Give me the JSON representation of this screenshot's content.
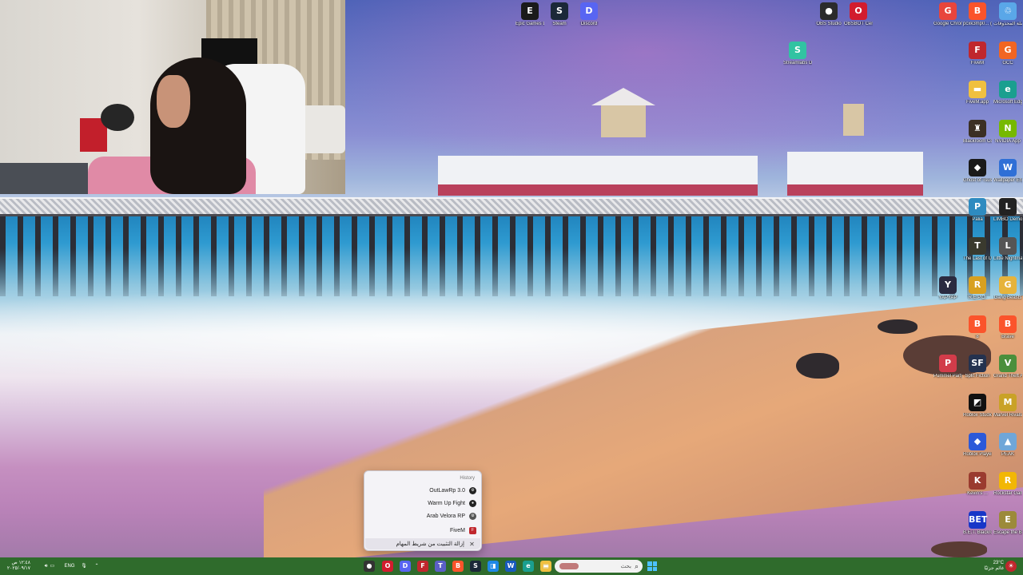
{
  "desktop": {
    "icons_top": [
      {
        "label": "Epic Games Launcher",
        "glyph": "E",
        "color": "#1a1a1a",
        "icon": "epic-games-icon"
      },
      {
        "label": "Steam",
        "glyph": "S",
        "color": "#1b2838",
        "icon": "steam-icon"
      },
      {
        "label": "Discord",
        "glyph": "D",
        "color": "#5865f2",
        "icon": "discord-icon"
      },
      {
        "label": "OBS Studio",
        "glyph": "●",
        "color": "#2b2b2b",
        "icon": "obs-icon"
      },
      {
        "label": "OBSBOT Center",
        "glyph": "O",
        "color": "#d21c2e",
        "icon": "obsbot-icon"
      },
      {
        "label": "Streamlabs Desktop",
        "glyph": "S",
        "color": "#31c3a2",
        "icon": "streamlabs-icon"
      }
    ],
    "icons_right": [
      {
        "label": "Google Chrome",
        "glyph": "G",
        "color": "#e8453c",
        "icon": "chrome-icon"
      },
      {
        "label": "pcxk3mp0... (2)",
        "glyph": "B",
        "color": "#fb542b",
        "icon": "brave-icon"
      },
      {
        "label": "سلة المحذوفات",
        "glyph": "♲",
        "color": "#5aa7e8",
        "icon": "recycle-bin-icon"
      },
      {
        "label": "FiveM",
        "glyph": "F",
        "color": "#c0272d",
        "icon": "fivem-icon"
      },
      {
        "label": "GCC",
        "glyph": "G",
        "color": "#f26522",
        "icon": "gcc-icon"
      },
      {
        "label": "FiveM.app",
        "glyph": "▬",
        "color": "#f0c040",
        "icon": "folder-icon"
      },
      {
        "label": "Microsoft Edge",
        "glyph": "e",
        "color": "#1a9f8f",
        "icon": "edge-icon"
      },
      {
        "label": "Blackroom Company",
        "glyph": "♜",
        "color": "#3b2f24",
        "icon": "blackroom-icon"
      },
      {
        "label": "NVIDIA App",
        "glyph": "N",
        "color": "#76b900",
        "icon": "nvidia-icon"
      },
      {
        "label": "Ghost of Tsushima",
        "glyph": "◆",
        "color": "#1a1a1a",
        "icon": "ghost-icon"
      },
      {
        "label": "Wallpaper Engine",
        "glyph": "W",
        "color": "#2f6fd6",
        "icon": "wallpaper-engine-icon"
      },
      {
        "label": "Palia",
        "glyph": "P",
        "color": "#2e8bc0",
        "icon": "palia-icon"
      },
      {
        "label": "LIMBO Demo",
        "glyph": "L",
        "color": "#222222",
        "icon": "limbo-icon"
      },
      {
        "label": "The Last of Us™ Part I",
        "glyph": "T",
        "color": "#3a3a2e",
        "icon": "tlou-icon"
      },
      {
        "label": "Little Nightmares",
        "glyph": "L",
        "color": "#555555",
        "icon": "little-nightmares-icon"
      },
      {
        "label": "YAPYAP",
        "glyph": "Y",
        "color": "#2b2b40",
        "icon": "yapyap-icon"
      },
      {
        "label": "R.E.P.O.",
        "glyph": "R",
        "color": "#d8a020",
        "icon": "repo-icon"
      },
      {
        "label": "Gang Beasts",
        "glyph": "G",
        "color": "#e6b33b",
        "icon": "gang-beasts-icon"
      },
      {
        "label": "8",
        "glyph": "B",
        "color": "#fb542b",
        "icon": "brave-icon"
      },
      {
        "label": "Brave",
        "glyph": "B",
        "color": "#fb542b",
        "icon": "brave-icon"
      },
      {
        "label": "Pummel Party",
        "glyph": "P",
        "color": "#d23c4a",
        "icon": "pummel-party-icon"
      },
      {
        "label": "Split Fiction",
        "glyph": "SF",
        "color": "#24324f",
        "icon": "split-fiction-icon"
      },
      {
        "label": "Grand Theft Auto V Le...",
        "glyph": "V",
        "color": "#4a8f3c",
        "icon": "gta-icon"
      },
      {
        "label": "Roblox Studio",
        "glyph": "◩",
        "color": "#111111",
        "icon": "roblox-studio-icon"
      },
      {
        "label": "Marvel Rivals",
        "glyph": "M",
        "color": "#c9a227",
        "icon": "marvel-rivals-icon"
      },
      {
        "label": "Roblox Player",
        "glyph": "◆",
        "color": "#2b59d9",
        "icon": "roblox-player-icon"
      },
      {
        "label": "PEAK",
        "glyph": "▲",
        "color": "#6fa6d8",
        "icon": "peak-icon"
      },
      {
        "label": "Kevin's ...",
        "glyph": "K",
        "color": "#9a3b2f",
        "icon": "game-icon"
      },
      {
        "label": "Rockstar Games ...",
        "glyph": "R",
        "color": "#f2b705",
        "icon": "rockstar-icon"
      },
      {
        "label": "B.E.T. Blackroom Escape T...",
        "glyph": "BET",
        "color": "#1836c8",
        "icon": "bet-icon"
      },
      {
        "label": "Escape the Backrooms",
        "glyph": "E",
        "color": "#9c8a3a",
        "icon": "escape-backrooms-icon"
      }
    ]
  },
  "jumplist": {
    "header": "History",
    "items": [
      {
        "label": "OutLawRp 3.0",
        "icon": "fivem-server-icon",
        "kind": "round"
      },
      {
        "label": "Warm Up Fight",
        "icon": "fivem-server-icon",
        "kind": "round"
      },
      {
        "label": "Arab Velora RP",
        "icon": "fivem-server-icon",
        "kind": "round"
      }
    ],
    "app_item": {
      "label": "FiveM",
      "icon": "fivem-icon"
    },
    "unpin_item": {
      "label": "إزالة التثبيت من شريط المهام",
      "icon": "unpin-icon"
    }
  },
  "taskbar": {
    "search_placeholder": "بحث",
    "weather_temp": "23°C",
    "weather_desc": "غائم جزئيًا",
    "time": "١٢:٤٨ ص",
    "date": "٢٠٢٥/٠٩/١٧",
    "lang": "ENG",
    "apps": [
      {
        "name": "obs-taskbar-icon",
        "glyph": "●",
        "color": "#333333"
      },
      {
        "name": "obsbot-taskbar-icon",
        "glyph": "O",
        "color": "#d21c2e"
      },
      {
        "name": "discord-taskbar-icon",
        "glyph": "D",
        "color": "#5865f2"
      },
      {
        "name": "fivem-taskbar-icon",
        "glyph": "F",
        "color": "#c0272d"
      },
      {
        "name": "teams-taskbar-icon",
        "glyph": "T",
        "color": "#5b5fc7"
      },
      {
        "name": "brave-taskbar-icon",
        "glyph": "B",
        "color": "#fb542b"
      },
      {
        "name": "steam-taskbar-icon",
        "glyph": "S",
        "color": "#1b2838"
      },
      {
        "name": "store-taskbar-icon",
        "glyph": "◨",
        "color": "#1e88e5"
      },
      {
        "name": "word-taskbar-icon",
        "glyph": "W",
        "color": "#185abd"
      },
      {
        "name": "edge-taskbar-icon",
        "glyph": "e",
        "color": "#1a9f8f"
      },
      {
        "name": "explorer-taskbar-icon",
        "glyph": "▬",
        "color": "#f0c040"
      },
      {
        "name": "task-view-taskbar-icon",
        "glyph": "▢",
        "color": "#555555"
      }
    ]
  }
}
